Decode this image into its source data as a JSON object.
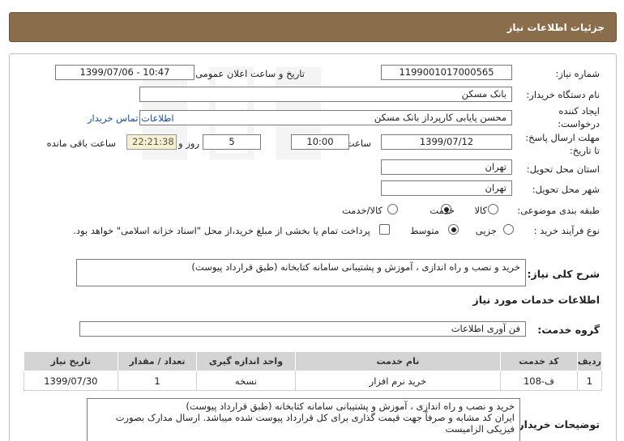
{
  "header": {
    "title": "جزئیات اطلاعات نیاز"
  },
  "form": {
    "need_number_label": "شماره نیاز:",
    "need_number": "1199001017000565",
    "announce_label": "تاریخ و ساعت اعلان عمومی:",
    "announce_value": "1399/07/06 - 10:47",
    "buyer_org_label": "نام دستگاه خریدار:",
    "buyer_org": "بانک مسکن",
    "creator_label_1": "ایجاد کننده",
    "creator_label_2": "درخواست:",
    "creator": "محسن پایابی کارپرداز بانک مسکن",
    "contact_link": "اطلاعات تماس خریدار",
    "deadline_label_1": "مهلت ارسال پاسخ:",
    "deadline_label_2": "تا تاریخ:",
    "deadline_date": "1399/07/12",
    "time_label": "ساعت",
    "deadline_time": "10:00",
    "days_value": "5",
    "days_label": "روز و",
    "timer_value": "22:21:38",
    "remaining_label": "ساعت باقی مانده",
    "province_label": "استان محل تحویل:",
    "province": "تهران",
    "city_label": "شهر محل تحویل:",
    "city": "تهران",
    "category_label": "طبقه بندی موضوعی:",
    "category_options": [
      "کالا",
      "خدمت",
      "کالا/خدمت"
    ],
    "category_selected": "خدمت",
    "process_label": "نوع فرآیند خرید :",
    "process_options": [
      "جزیی",
      "متوسط"
    ],
    "process_selected": "متوسط",
    "payment_note": "پرداخت تمام یا بخشی از مبلغ خرید،از محل \"اسناد خزانه اسلامی\" خواهد بود."
  },
  "summary": {
    "label": "شرح کلی نیاز:",
    "value": "خرید و نصب و راه اندازی ، آموزش و پشتیبانی سامانه کتابخانه (طبق قرارداد پیوست)"
  },
  "services_section": {
    "title": "اطلاعات خدمات مورد نیاز"
  },
  "service_group": {
    "label": "گروه خدمت:",
    "value": "فن آوری اطلاعات"
  },
  "table": {
    "headers": [
      "ردیف",
      "کد خدمت",
      "نام خدمت",
      "واحد اندازه گیری",
      "تعداد / مقدار",
      "تاریخ نیاز"
    ],
    "rows": [
      [
        "1",
        "ف-108",
        "خرید نرم افزار",
        "نسخه",
        "1",
        "1399/07/30"
      ]
    ]
  },
  "buyer_notes": {
    "label": "توضیحات خریدار:",
    "line1": "خرید و نصب و راه اندازی ، آموزش و پشتیبانی سامانه کتابخانه (طبق قرارداد پیوست)",
    "line2": "ایران کد مشابه و صرفاً جهت قیمت گذاری برای کل قرارداد پیوست شده میباشد. ارسال مدارک بصورت",
    "line3": "فیزیکی الزامیست"
  }
}
